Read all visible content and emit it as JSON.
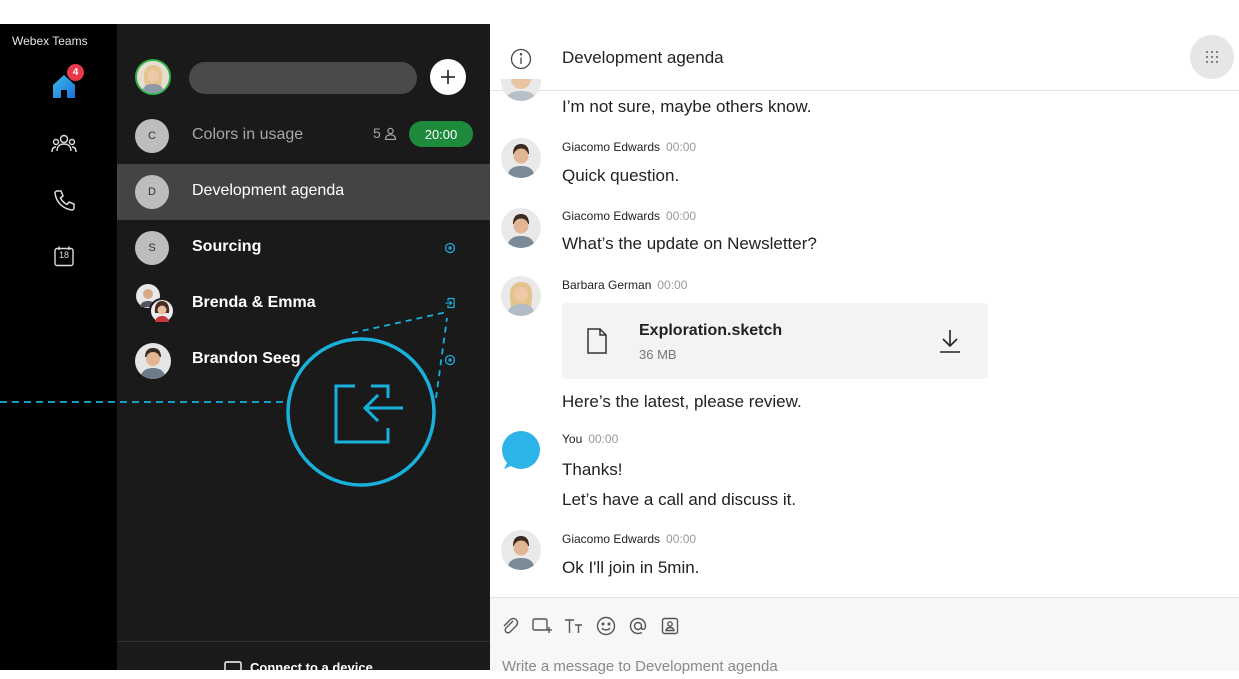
{
  "app": {
    "name": "Webex Teams"
  },
  "rail": {
    "home_badge": "4",
    "calendar_day": "18",
    "icons": [
      "home-icon",
      "people-icon",
      "phone-icon",
      "calendar-icon"
    ]
  },
  "spaces": {
    "search_placeholder": "",
    "items": [
      {
        "letter": "C",
        "title": "Colors in usage",
        "members": "5",
        "timer": "20:00"
      },
      {
        "letter": "D",
        "title": "Development agenda"
      },
      {
        "letter": "S",
        "title": "Sourcing"
      },
      {
        "title": "Brenda & Emma"
      },
      {
        "title": "Brandon Seeg"
      }
    ],
    "connect_label": "Connect to a device"
  },
  "conversation": {
    "title": "Development agenda",
    "messages": [
      {
        "text": "I’m not sure, maybe others know."
      },
      {
        "sender": "Giacomo Edwards",
        "time": "00:00",
        "text": "Quick question."
      },
      {
        "sender": "Giacomo Edwards",
        "time": "00:00",
        "text": "What’s the update on Newsletter?"
      },
      {
        "sender": "Barbara German",
        "time": "00:00",
        "file_name": "Exploration.sketch",
        "file_size": "36 MB",
        "text": "Here’s the latest, please review."
      },
      {
        "sender": "You",
        "time": "00:00",
        "text": "Thanks!",
        "text2": "Let’s have a call and discuss it."
      },
      {
        "sender": "Giacomo Edwards",
        "time": "00:00",
        "text": "Ok I'll join in 5min."
      }
    ],
    "composer_placeholder": "Write a message to Development agenda"
  },
  "colors": {
    "accent": "#1ab0dc",
    "badge": "#e8394a",
    "timer": "#1e8b3c",
    "rail_bg": "#000000",
    "list_bg": "#1a1a1a"
  }
}
